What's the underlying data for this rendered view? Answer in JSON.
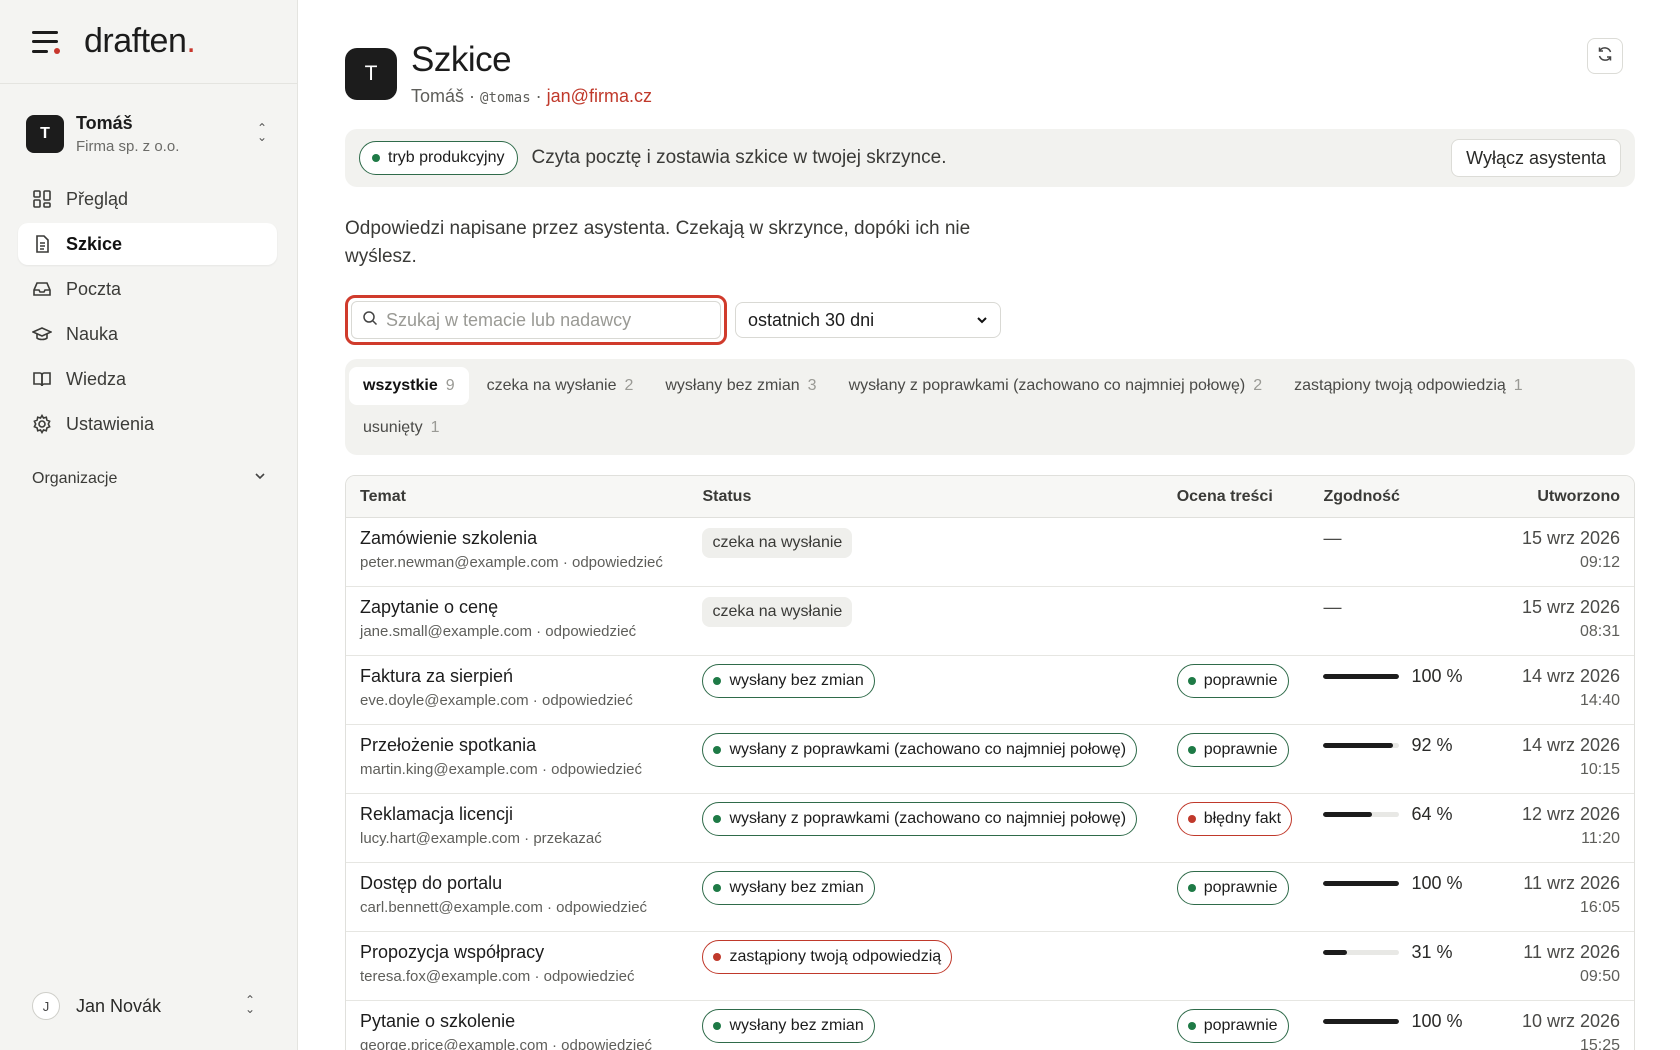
{
  "app": {
    "logo_text": "draften",
    "logo_dot": "."
  },
  "account": {
    "initial": "T",
    "name": "Tomáš",
    "org": "Firma sp. z o.o."
  },
  "nav": [
    {
      "label": "Přegląd",
      "icon": "grid-icon"
    },
    {
      "label": "Szkice",
      "icon": "document-icon"
    },
    {
      "label": "Poczta",
      "icon": "inbox-icon"
    },
    {
      "label": "Nauka",
      "icon": "graduation-cap-icon"
    },
    {
      "label": "Wiedza",
      "icon": "book-icon"
    },
    {
      "label": "Ustawienia",
      "icon": "gear-icon"
    }
  ],
  "organizations_label": "Organizacje",
  "user": {
    "initial": "J",
    "name": "Jan Novák"
  },
  "header": {
    "initial": "T",
    "title": "Szkice",
    "name": "Tomáš",
    "handle": "@tomas",
    "email": "jan@firma.cz",
    "sep": "·"
  },
  "banner": {
    "mode": "tryb produkcyjny",
    "text": "Czyta pocztę i zostawia szkice w twojej skrzynce.",
    "button": "Wyłącz asystenta"
  },
  "intro": "Odpowiedzi napisane przez asystenta. Czekają w skrzynce, dopóki ich nie wyślesz.",
  "search": {
    "placeholder": "Szukaj w temacie lub nadawcy",
    "value": ""
  },
  "period": {
    "selected": "ostatnich 30 dni"
  },
  "tabs": [
    {
      "label": "wszystkie",
      "count": "9"
    },
    {
      "label": "czeka na wysłanie",
      "count": "2"
    },
    {
      "label": "wysłany bez zmian",
      "count": "3"
    },
    {
      "label": "wysłany z poprawkami (zachowano co najmniej połowę)",
      "count": "2"
    },
    {
      "label": "zastąpiony twoją odpowiedzią",
      "count": "1"
    },
    {
      "label": "usunięty",
      "count": "1"
    }
  ],
  "table": {
    "headers": {
      "subject": "Temat",
      "status": "Status",
      "eval": "Ocena treści",
      "match": "Zgodność",
      "created": "Utworzono"
    },
    "rows": [
      {
        "subject": "Zamówienie szkolenia",
        "meta": "peter.newman@example.com · odpowiedzieć",
        "status": "czeka na wysłanie",
        "status_type": "grey",
        "eval": "",
        "eval_type": "",
        "match": "—",
        "match_value": null,
        "date": "15 wrz 2026",
        "time": "09:12"
      },
      {
        "subject": "Zapytanie o cenę",
        "meta": "jane.small@example.com · odpowiedzieć",
        "status": "czeka na wysłanie",
        "status_type": "grey",
        "eval": "",
        "eval_type": "",
        "match": "—",
        "match_value": null,
        "date": "15 wrz 2026",
        "time": "08:31"
      },
      {
        "subject": "Faktura za sierpień",
        "meta": "eve.doyle@example.com · odpowiedzieć",
        "status": "wysłany bez zmian",
        "status_type": "green",
        "eval": "poprawnie",
        "eval_type": "green",
        "match": "100 %",
        "match_value": 100,
        "date": "14 wrz 2026",
        "time": "14:40"
      },
      {
        "subject": "Przełożenie spotkania",
        "meta": "martin.king@example.com · odpowiedzieć",
        "status": "wysłany z poprawkami (zachowano co najmniej połowę)",
        "status_type": "green",
        "eval": "poprawnie",
        "eval_type": "green",
        "match": "92 %",
        "match_value": 92,
        "date": "14 wrz 2026",
        "time": "10:15"
      },
      {
        "subject": "Reklamacja licencji",
        "meta": "lucy.hart@example.com · przekazać",
        "status": "wysłany z poprawkami (zachowano co najmniej połowę)",
        "status_type": "green",
        "eval": "błędny fakt",
        "eval_type": "red",
        "match": "64 %",
        "match_value": 64,
        "date": "12 wrz 2026",
        "time": "11:20"
      },
      {
        "subject": "Dostęp do portalu",
        "meta": "carl.bennett@example.com · odpowiedzieć",
        "status": "wysłany bez zmian",
        "status_type": "green",
        "eval": "poprawnie",
        "eval_type": "green",
        "match": "100 %",
        "match_value": 100,
        "date": "11 wrz 2026",
        "time": "16:05"
      },
      {
        "subject": "Propozycja współpracy",
        "meta": "teresa.fox@example.com · odpowiedzieć",
        "status": "zastąpiony twoją odpowiedzią",
        "status_type": "red",
        "eval": "",
        "eval_type": "",
        "match": "31 %",
        "match_value": 31,
        "date": "11 wrz 2026",
        "time": "09:50"
      },
      {
        "subject": "Pytanie o szkolenie",
        "meta": "george.price@example.com · odpowiedzieć",
        "status": "wysłany bez zmian",
        "status_type": "green",
        "eval": "poprawnie",
        "eval_type": "green",
        "match": "100 %",
        "match_value": 100,
        "date": "10 wrz 2026",
        "time": "15:25"
      }
    ]
  },
  "colors": {
    "accent_red": "#c0392b",
    "status_green": "#1e7a46",
    "ink": "#1c1c1c"
  }
}
